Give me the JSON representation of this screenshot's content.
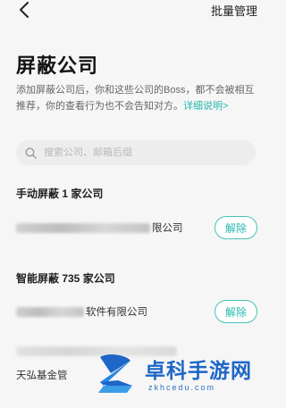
{
  "header": {
    "back_icon": "chevron-left-icon",
    "batch_manage_label": "批量管理"
  },
  "page": {
    "title": "屏蔽公司",
    "description": "添加屏蔽公司后，你和这些公司的Boss，都不会被相互推荐，你的查看行为也不会告知对方。",
    "details_link": "详细说明>"
  },
  "search": {
    "icon": "search-icon",
    "placeholder": "搜索公司、邮箱后缀"
  },
  "manual_section": {
    "title": "手动屏蔽 1 家公司",
    "items": [
      {
        "name_suffix": "限公司",
        "action_label": "解除"
      }
    ]
  },
  "smart_section": {
    "title": "智能屏蔽 735 家公司",
    "items": [
      {
        "name_suffix": "软件有限公司",
        "action_label": "解除"
      },
      {
        "name_suffix": ""
      },
      {
        "name_suffix": "天弘基金管"
      }
    ]
  },
  "watermark": {
    "text": "卓科手游网",
    "url": "zkhcedu.com"
  },
  "colors": {
    "accent": "#26b7ad",
    "background": "#f6f6f6",
    "watermark_blue": "#1e66c8"
  }
}
